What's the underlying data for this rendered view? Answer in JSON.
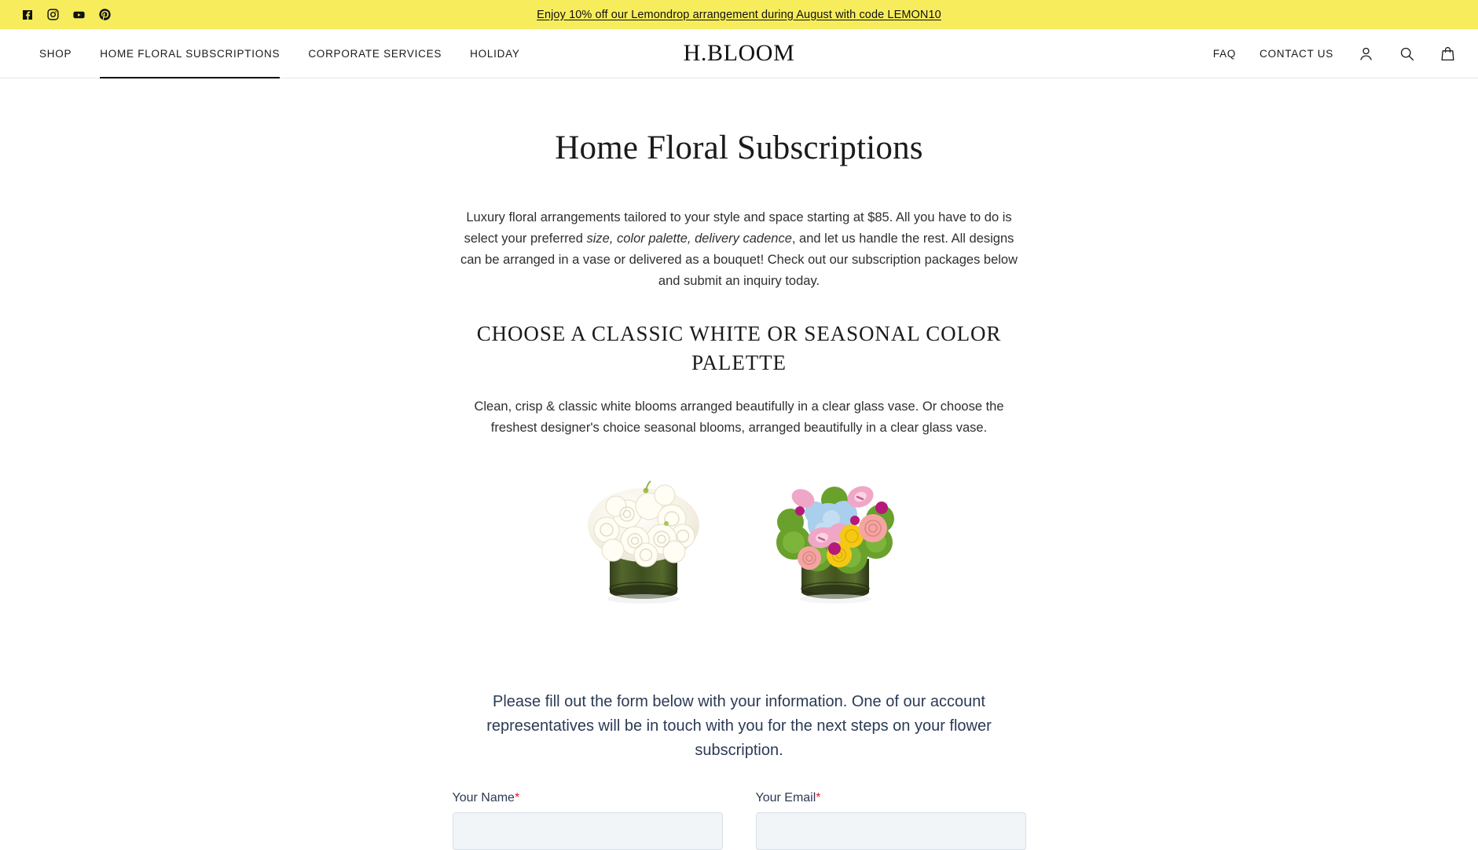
{
  "announcement": {
    "link_text": "Enjoy 10% off our Lemondrop arrangement during August with code LEMON10",
    "background_color": "#F7ED5C",
    "social": [
      {
        "name": "facebook",
        "label": "Facebook"
      },
      {
        "name": "instagram",
        "label": "Instagram"
      },
      {
        "name": "youtube",
        "label": "Youtube"
      },
      {
        "name": "pinterest",
        "label": "Pinterest"
      }
    ]
  },
  "header": {
    "logo": "H.BLOOM",
    "nav_left": [
      {
        "label": "SHOP",
        "active": false
      },
      {
        "label": "HOME FLORAL SUBSCRIPTIONS",
        "active": true
      },
      {
        "label": "CORPORATE SERVICES",
        "active": false
      },
      {
        "label": "HOLIDAY",
        "active": false
      }
    ],
    "nav_right": [
      {
        "label": "FAQ"
      },
      {
        "label": "CONTACT US"
      }
    ],
    "icons": [
      {
        "name": "account-icon",
        "label": "Account"
      },
      {
        "name": "search-icon",
        "label": "Search"
      },
      {
        "name": "cart-icon",
        "label": "Cart"
      }
    ]
  },
  "main": {
    "page_title": "Home Floral Subscriptions",
    "intro_part1": "Luxury floral arrangements tailored to your style and space starting at $85. All you have to do is select your preferred ",
    "intro_italic": "size, color palette, delivery cadence",
    "intro_part2": ", and let us handle the rest.  All designs can be arranged in a vase or delivered as a bouquet! Check out our subscription packages below and submit an inquiry today.",
    "section_heading": "CHOOSE A CLASSIC WHITE OR SEASONAL COLOR PALETTE",
    "section_sub": "Clean, crisp & classic white blooms arranged beautifully in a clear glass vase. Or choose the freshest designer's choice seasonal blooms, arranged beautifully in a clear glass vase.",
    "arrangements": [
      {
        "name": "white-arrangement",
        "alt": "Classic white floral arrangement in clear glass vase"
      },
      {
        "name": "seasonal-arrangement",
        "alt": "Seasonal colorful floral arrangement in clear glass vase"
      }
    ],
    "form_intro": "Please fill out the form below with your information. One of our account representatives will be in touch with you for the next steps on your flower subscription.",
    "form": {
      "fields": [
        {
          "label": "Your Name",
          "required": "*",
          "value": "",
          "placeholder": ""
        },
        {
          "label": "Your Email",
          "required": "*",
          "value": "",
          "placeholder": ""
        }
      ]
    }
  },
  "colors": {
    "accent_yellow": "#F7ED5C",
    "text_dark": "#1b1b1b",
    "text_navy": "#2b3a55",
    "required_red": "#e8192c",
    "input_bg": "#F1F5F8"
  }
}
